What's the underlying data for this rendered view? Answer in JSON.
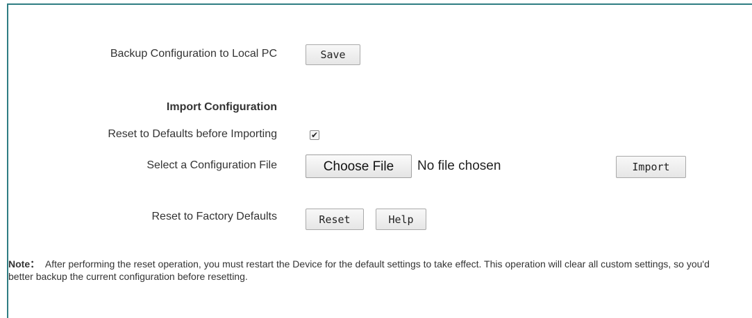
{
  "backup": {
    "label": "Backup Configuration to Local PC",
    "save_button": "Save"
  },
  "import": {
    "heading": "Import Configuration",
    "reset_before_label": "Reset to Defaults before Importing",
    "reset_before_checked": true,
    "checkbox_glyph": "✔",
    "select_file_label": "Select a Configuration File",
    "choose_file_button": "Choose File",
    "file_status": "No file chosen",
    "import_button": "Import"
  },
  "factory": {
    "label": "Reset to Factory Defaults",
    "reset_button": "Reset",
    "help_button": "Help"
  },
  "note": {
    "prefix": "Note：",
    "text": "After performing the reset operation, you must restart the Device for the default settings to take effect. This operation will clear all custom settings, so you'd better backup the current configuration before resetting."
  },
  "colors": {
    "panel_border": "#2e7d82",
    "text": "#333333"
  }
}
